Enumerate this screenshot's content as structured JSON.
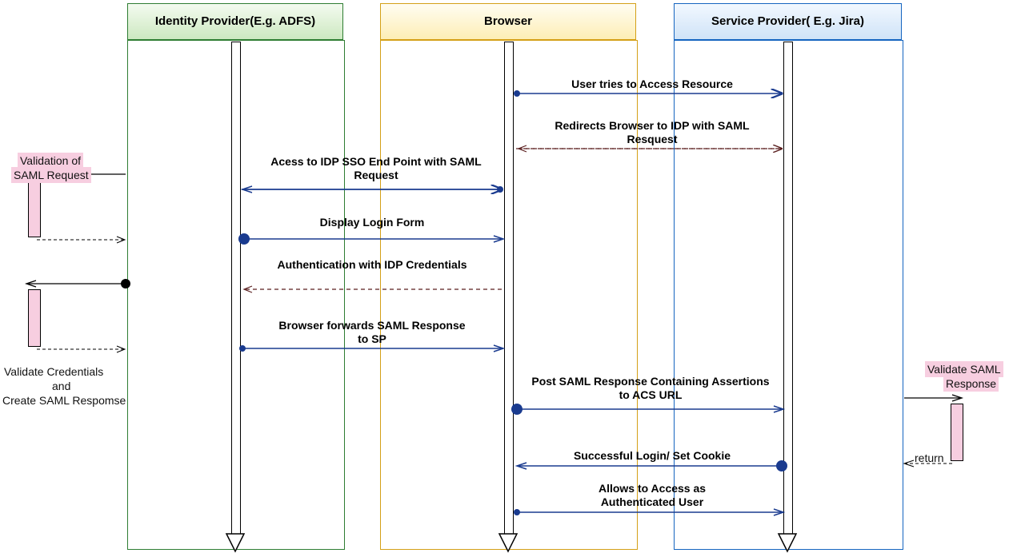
{
  "participants": {
    "idp": {
      "label": "Identity Provider(E.g. ADFS)"
    },
    "browser": {
      "label": "Browser"
    },
    "sp": {
      "label": "Service Provider( E.g. Jira)"
    }
  },
  "messages": {
    "m1": "User tries to Access Resource",
    "m2": "Redirects Browser to IDP with SAML Resquest",
    "m3": "Acess to IDP SSO End Point with SAML Request",
    "m4": "Display Login Form",
    "m5": "Authentication with IDP Credentials",
    "m6": "Browser forwards SAML Response to SP",
    "m7": "Post SAML Response Containing Assertions to ACS URL",
    "m8": "Successful Login/ Set Cookie",
    "m9": "Allows to Access as Authenticated User"
  },
  "notes": {
    "n1": "Validation of SAML Request",
    "n2": "Validate Credentials and\nCreate SAML Respomse",
    "n3": "Validate SAML Response",
    "n4": "return"
  },
  "colors": {
    "idp_header_top": "#f4fbf0",
    "idp_header_bot": "#cce8c0",
    "idp_border": "#2e7d32",
    "browser_header_top": "#fffdf2",
    "browser_header_bot": "#fdeeb5",
    "browser_border": "#d4a017",
    "sp_header_top": "#f2f8ff",
    "sp_header_bot": "#cfe3f7",
    "sp_border": "#1565c0",
    "arrow": "#1a3b8f",
    "dashed_dark": "#5a1f1f",
    "marker_fill": "#1a3b8f",
    "activation": "#f7cee0"
  }
}
